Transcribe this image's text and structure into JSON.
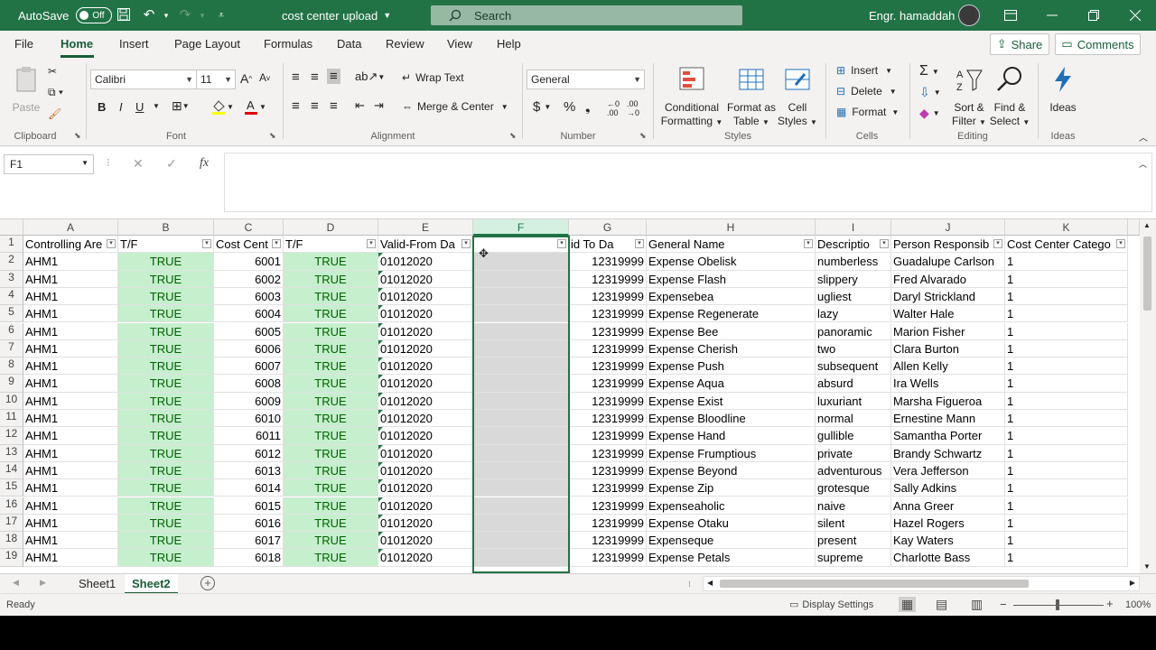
{
  "titlebar": {
    "autosave_label": "AutoSave",
    "autosave_state": "Off",
    "doc_title": "cost center upload",
    "search_placeholder": "Search",
    "user_name": "Engr. hamaddah"
  },
  "menu": {
    "tabs": [
      "File",
      "Home",
      "Insert",
      "Page Layout",
      "Formulas",
      "Data",
      "Review",
      "View",
      "Help"
    ],
    "active": "Home",
    "share": "Share",
    "comments": "Comments"
  },
  "ribbon": {
    "clipboard": {
      "paste": "Paste",
      "label": "Clipboard"
    },
    "font": {
      "name": "Calibri",
      "size": "11",
      "bold": "B",
      "italic": "I",
      "underline": "U",
      "label": "Font"
    },
    "alignment": {
      "wrap_text": "Wrap Text",
      "merge_center": "Merge & Center",
      "label": "Alignment"
    },
    "number": {
      "format": "General",
      "label": "Number"
    },
    "styles": {
      "conditional": [
        "Conditional",
        "Formatting"
      ],
      "format_as_table": [
        "Format as",
        "Table"
      ],
      "cell_styles": [
        "Cell",
        "Styles"
      ],
      "label": "Styles"
    },
    "cells": {
      "insert": "Insert",
      "delete": "Delete",
      "format": "Format",
      "label": "Cells"
    },
    "editing": {
      "sort_filter": [
        "Sort &",
        "Filter"
      ],
      "find_select": [
        "Find &",
        "Select"
      ],
      "label": "Editing"
    },
    "ideas": {
      "ideas": "Ideas",
      "label": "Ideas"
    }
  },
  "formula_bar": {
    "name_box": "F1",
    "fx": "fx",
    "content": ""
  },
  "columns": [
    "A",
    "B",
    "C",
    "D",
    "E",
    "F",
    "G",
    "H",
    "I",
    "J",
    "K"
  ],
  "headers": [
    "Controlling Are",
    "T/F",
    "Cost Cent",
    "T/F",
    "Valid-From Da",
    "",
    "id To Da",
    "General Name",
    "Descriptio",
    "Person Responsib",
    "Cost Center Catego"
  ],
  "rows": [
    {
      "n": "2",
      "a": "AHM1",
      "b": "TRUE",
      "c": "6001",
      "d": "TRUE",
      "e": "01012020",
      "g": "12319999",
      "h": "Expense Obelisk",
      "i": "numberless",
      "j": "Guadalupe Carlson",
      "k": "1"
    },
    {
      "n": "3",
      "a": "AHM1",
      "b": "TRUE",
      "c": "6002",
      "d": "TRUE",
      "e": "01012020",
      "g": "12319999",
      "h": "Expense Flash",
      "i": "slippery",
      "j": "Fred Alvarado",
      "k": "1"
    },
    {
      "n": "4",
      "a": "AHM1",
      "b": "TRUE",
      "c": "6003",
      "d": "TRUE",
      "e": "01012020",
      "g": "12319999",
      "h": "Expensebea",
      "i": "ugliest",
      "j": "Daryl Strickland",
      "k": "1"
    },
    {
      "n": "5",
      "a": "AHM1",
      "b": "TRUE",
      "c": "6004",
      "d": "TRUE",
      "e": "01012020",
      "g": "12319999",
      "h": "Expense Regenerate",
      "i": "lazy",
      "j": "Walter Hale",
      "k": "1"
    },
    {
      "n": "6",
      "a": "AHM1",
      "b": "TRUE",
      "c": "6005",
      "d": "TRUE",
      "e": "01012020",
      "g": "12319999",
      "h": "Expense Bee",
      "i": "panoramic",
      "j": "Marion Fisher",
      "k": "1"
    },
    {
      "n": "7",
      "a": "AHM1",
      "b": "TRUE",
      "c": "6006",
      "d": "TRUE",
      "e": "01012020",
      "g": "12319999",
      "h": "Expense Cherish",
      "i": "two",
      "j": "Clara Burton",
      "k": "1"
    },
    {
      "n": "8",
      "a": "AHM1",
      "b": "TRUE",
      "c": "6007",
      "d": "TRUE",
      "e": "01012020",
      "g": "12319999",
      "h": "Expense Push",
      "i": "subsequent",
      "j": "Allen Kelly",
      "k": "1"
    },
    {
      "n": "9",
      "a": "AHM1",
      "b": "TRUE",
      "c": "6008",
      "d": "TRUE",
      "e": "01012020",
      "g": "12319999",
      "h": "Expense Aqua",
      "i": "absurd",
      "j": "Ira Wells",
      "k": "1"
    },
    {
      "n": "10",
      "a": "AHM1",
      "b": "TRUE",
      "c": "6009",
      "d": "TRUE",
      "e": "01012020",
      "g": "12319999",
      "h": "Expense Exist",
      "i": "luxuriant",
      "j": "Marsha Figueroa",
      "k": "1"
    },
    {
      "n": "11",
      "a": "AHM1",
      "b": "TRUE",
      "c": "6010",
      "d": "TRUE",
      "e": "01012020",
      "g": "12319999",
      "h": "Expense Bloodline",
      "i": "normal",
      "j": "Ernestine Mann",
      "k": "1"
    },
    {
      "n": "12",
      "a": "AHM1",
      "b": "TRUE",
      "c": "6011",
      "d": "TRUE",
      "e": "01012020",
      "g": "12319999",
      "h": "Expense Hand",
      "i": "gullible",
      "j": "Samantha Porter",
      "k": "1"
    },
    {
      "n": "13",
      "a": "AHM1",
      "b": "TRUE",
      "c": "6012",
      "d": "TRUE",
      "e": "01012020",
      "g": "12319999",
      "h": "Expense Frumptious",
      "i": "private",
      "j": "Brandy Schwartz",
      "k": "1"
    },
    {
      "n": "14",
      "a": "AHM1",
      "b": "TRUE",
      "c": "6013",
      "d": "TRUE",
      "e": "01012020",
      "g": "12319999",
      "h": "Expense Beyond",
      "i": "adventurous",
      "j": "Vera Jefferson",
      "k": "1"
    },
    {
      "n": "15",
      "a": "AHM1",
      "b": "TRUE",
      "c": "6014",
      "d": "TRUE",
      "e": "01012020",
      "g": "12319999",
      "h": "Expense Zip",
      "i": "grotesque",
      "j": "Sally Adkins",
      "k": "1"
    },
    {
      "n": "16",
      "a": "AHM1",
      "b": "TRUE",
      "c": "6015",
      "d": "TRUE",
      "e": "01012020",
      "g": "12319999",
      "h": "Expenseaholic",
      "i": "naive",
      "j": "Anna Greer",
      "k": "1"
    },
    {
      "n": "17",
      "a": "AHM1",
      "b": "TRUE",
      "c": "6016",
      "d": "TRUE",
      "e": "01012020",
      "g": "12319999",
      "h": "Expense Otaku",
      "i": "silent",
      "j": "Hazel Rogers",
      "k": "1"
    },
    {
      "n": "18",
      "a": "AHM1",
      "b": "TRUE",
      "c": "6017",
      "d": "TRUE",
      "e": "01012020",
      "g": "12319999",
      "h": "Expenseque",
      "i": "present",
      "j": "Kay Waters",
      "k": "1"
    },
    {
      "n": "19",
      "a": "AHM1",
      "b": "TRUE",
      "c": "6018",
      "d": "TRUE",
      "e": "01012020",
      "g": "12319999",
      "h": "Expense Petals",
      "i": "supreme",
      "j": "Charlotte Bass",
      "k": "1"
    }
  ],
  "sheets": [
    "Sheet1",
    "Sheet2"
  ],
  "active_sheet": "Sheet2",
  "status": {
    "ready": "Ready",
    "display_settings": "Display Settings",
    "zoom": "100%"
  }
}
